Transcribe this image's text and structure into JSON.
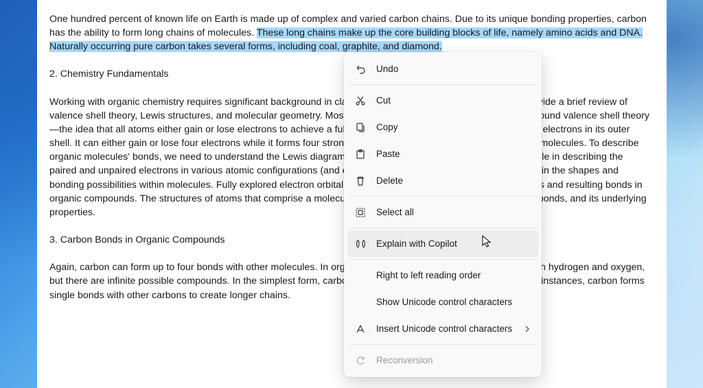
{
  "document": {
    "para1_a": "One hundred percent of known life on Earth is made up of complex and varied carbon chains. Due to its unique bonding properties, carbon has the ability to form long chains of molecules. ",
    "para1_hl": "These long chains make up the core building blocks of life, namely amino acids and DNA. Naturally occurring pure carbon takes several forms, including coal, graphite, and diamond.",
    "heading2": "2. Chemistry Fundamentals",
    "para2": "Working with organic chemistry requires significant background in classical chemistry fundamentals. Here, we provide a brief review of valence shell theory, Lewis structures, and molecular geometry. Most organic chemistry fundamentally revolves around valence shell theory—the idea that all atoms either gain or lose electrons to achieve a full outer shell. Carbon is perfect due to the four electrons in its outer shell. It can either gain or lose four electrons while it forms four strong covalent, atomic bonds with other atoms or molecules. To describe organic molecules' bonds, we need to understand the Lewis diagram system. Lewis dot structures play a pivotal role in describing the paired and unpaired electrons in various atomic configurations (and examining resonant structures) can help explain the shapes and bonding possibilities within molecules. Fully explored electron orbital shells can help illuminate the eventual shapes and resulting bonds in organic compounds. The structures of atoms that comprise a molecule can tell us its basic shape, the angle of its bonds, and its underlying properties.",
    "heading3": "3. Carbon Bonds in Organic Compounds",
    "para3": "Again, carbon can form up to four bonds with other molecules. In organic chemistry, we frequently see carbons with hydrogen and oxygen, but there are infinite possible compounds. In the simplest form, carbon forms four single hydrogen bonds. In other instances, carbon forms single bonds with other carbons to create longer chains."
  },
  "menu": {
    "undo": "Undo",
    "cut": "Cut",
    "copy": "Copy",
    "paste": "Paste",
    "delete": "Delete",
    "select_all": "Select all",
    "explain": "Explain with Copilot",
    "rtl": "Right to left reading order",
    "show_unicode": "Show Unicode control characters",
    "insert_unicode": "Insert Unicode control characters",
    "reconversion": "Reconversion"
  }
}
